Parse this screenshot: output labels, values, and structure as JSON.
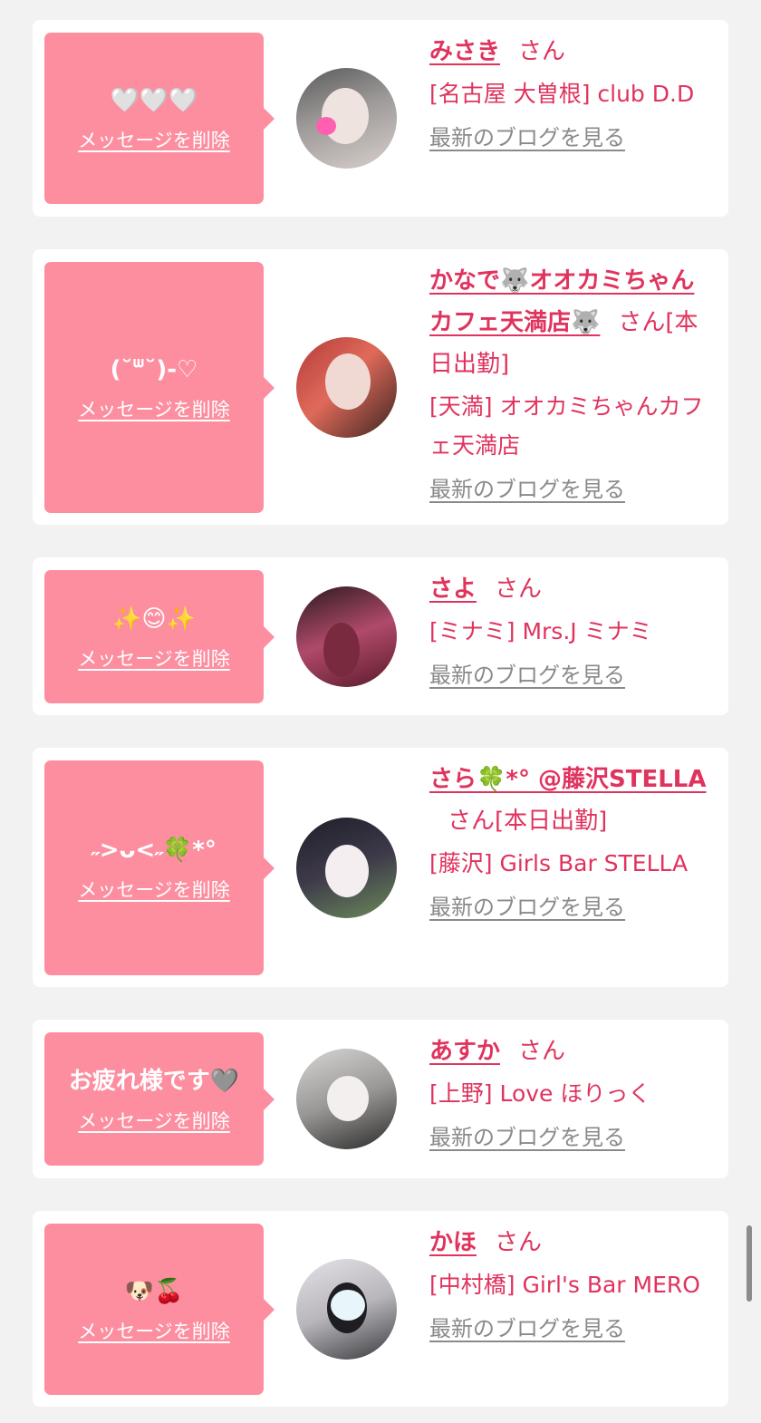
{
  "colors": {
    "page_bg": "#f2f2f2",
    "card_bg": "#ffffff",
    "bubble_bg": "#fd8ea0",
    "accent": "#e0335d",
    "link_gray": "#8a8a8a"
  },
  "labels": {
    "delete_message": "メッセージを削除",
    "view_blog": "最新のブログを見る",
    "honorific": "さん",
    "working_today": "[本日出勤]"
  },
  "items": [
    {
      "message": "🤍🤍🤍",
      "name": "みさき",
      "working": false,
      "shop": "[名古屋 大曽根] club D.D",
      "avatar_icon": "profile-photo"
    },
    {
      "message": "(˘ᐜ˘)-♡",
      "name": "かなで🐺オオカミちゃんカフェ天満店🐺",
      "working": true,
      "shop": "[天満] オオカミちゃんカフェ天満店",
      "avatar_icon": "profile-photo"
    },
    {
      "message": "✨😊✨",
      "name": "さよ",
      "working": false,
      "shop": "[ミナミ] Mrs.J ミナミ",
      "avatar_icon": "profile-photo"
    },
    {
      "message": "˶>ᴗ<˶🍀*°",
      "name": "さら🍀*° @藤沢STELLA",
      "working": true,
      "shop": "[藤沢] Girls Bar STELLA",
      "avatar_icon": "profile-photo"
    },
    {
      "message": "お疲れ様です🩶",
      "name": "あすか",
      "working": false,
      "shop": "[上野] Love ほりっく",
      "avatar_icon": "profile-photo"
    },
    {
      "message": "🐶🍒",
      "name": "かほ",
      "working": false,
      "shop": "[中村橋] Girl's Bar MERO",
      "avatar_icon": "profile-photo"
    }
  ]
}
